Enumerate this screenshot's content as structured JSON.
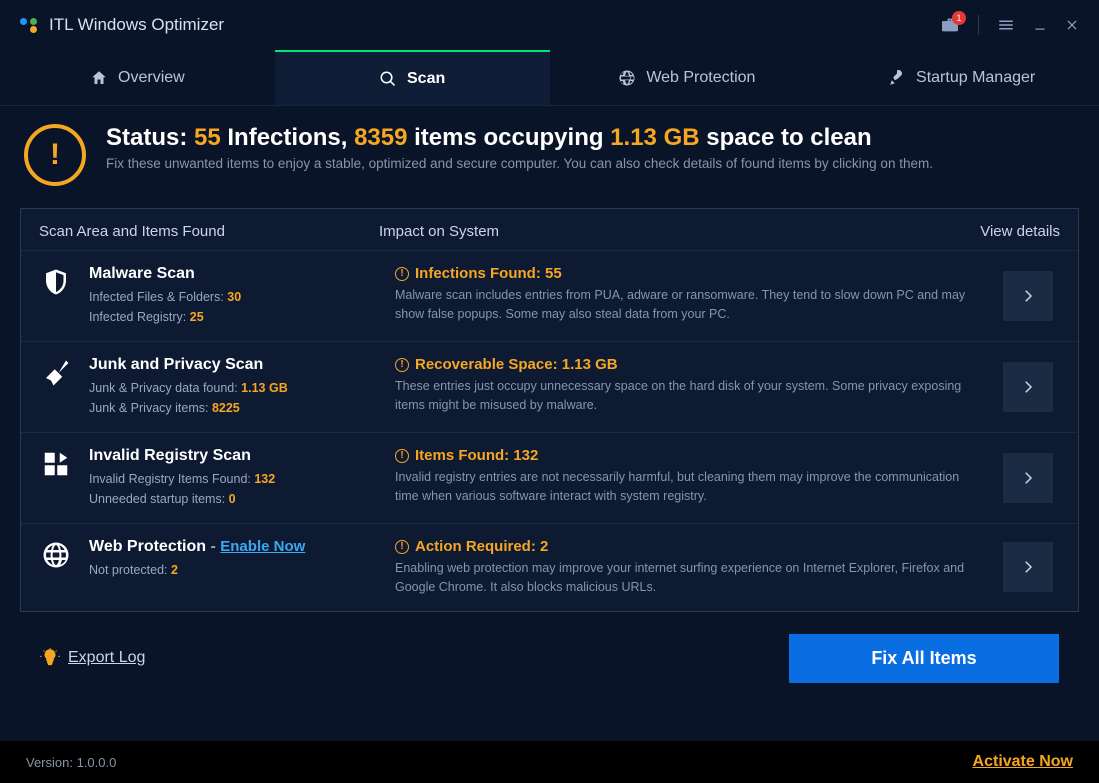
{
  "app": {
    "title": "ITL Windows Optimizer",
    "notif_count": "1"
  },
  "tabs": {
    "overview": "Overview",
    "scan": "Scan",
    "web": "Web Protection",
    "startup": "Startup Manager"
  },
  "status": {
    "label": "Status:",
    "infections_n": "55",
    "infections_word": "Infections,",
    "items_n": "8359",
    "items_word": "items occupying",
    "size": "1.13 GB",
    "size_word": "space to clean",
    "sub": "Fix these unwanted items to enjoy a stable, optimized and secure computer. You can also check details of found items by clicking on them."
  },
  "panel": {
    "head_c1": "Scan Area and Items Found",
    "head_c2": "Impact on System",
    "head_c3": "View details"
  },
  "rows": {
    "malware": {
      "title": "Malware Scan",
      "m1a": "Infected Files & Folders: ",
      "m1b": "30",
      "m2a": "Infected Registry: ",
      "m2b": "25",
      "impact_title": "Infections Found: 55",
      "impact_desc": "Malware scan includes entries from PUA, adware or ransomware. They tend to slow down PC and may show false popups. Some may also steal data from your PC."
    },
    "junk": {
      "title": "Junk and Privacy Scan",
      "m1a": "Junk & Privacy data found: ",
      "m1b": "1.13 GB",
      "m2a": "Junk & Privacy items: ",
      "m2b": "8225",
      "impact_title": "Recoverable Space: 1.13 GB",
      "impact_desc": "These entries just occupy unnecessary space on the hard disk of your system. Some privacy exposing items might be misused by malware."
    },
    "registry": {
      "title": "Invalid Registry Scan",
      "m1a": "Invalid Registry Items Found: ",
      "m1b": "132",
      "m2a": "Unneeded startup items: ",
      "m2b": "0",
      "impact_title": "Items Found: 132",
      "impact_desc": "Invalid registry entries are not necessarily harmful, but cleaning them may improve the communication time when various software interact with system registry."
    },
    "web": {
      "title": "Web Protection",
      "dash": "  -  ",
      "enable": "Enable Now",
      "m1a": "Not protected: ",
      "m1b": "2",
      "impact_title": "Action Required: 2",
      "impact_desc": "Enabling web protection may improve your internet surfing experience on Internet Explorer, Firefox and Google Chrome. It also blocks malicious URLs."
    }
  },
  "footer": {
    "export": "Export Log",
    "fix": "Fix All Items"
  },
  "bottom": {
    "version_label": "Version: ",
    "version": "1.0.0.0",
    "activate": "Activate Now"
  }
}
